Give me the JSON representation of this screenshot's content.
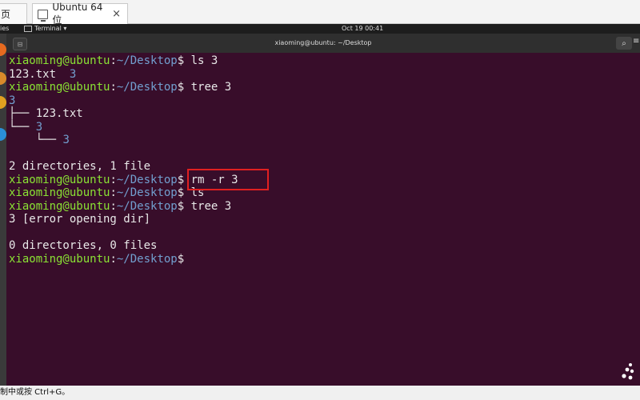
{
  "tabs": [
    {
      "label": "页",
      "close": ""
    },
    {
      "label": "Ubuntu 64 位",
      "close": "×"
    }
  ],
  "topbar": {
    "activities": "ies",
    "app_menu": "Terminal ▾",
    "clock": "Oct 19  00:41"
  },
  "terminal": {
    "window_title": "xiaoming@ubuntu: ~/Desktop",
    "prompt_user": "xiaoming@ubuntu",
    "prompt_path": "~/Desktop",
    "lines": [
      {
        "kind": "prompt",
        "cmd": "ls 3"
      },
      {
        "kind": "ls_output",
        "file": "123.txt",
        "dir": "3"
      },
      {
        "kind": "prompt",
        "cmd": "tree 3"
      },
      {
        "kind": "output",
        "text": "3",
        "is_dir": true
      },
      {
        "kind": "output",
        "text": "├── 123.txt"
      },
      {
        "kind": "tree_dir",
        "prefix": "└── ",
        "dir": "3"
      },
      {
        "kind": "tree_dir",
        "prefix": "    └── ",
        "dir": "3"
      },
      {
        "kind": "blank"
      },
      {
        "kind": "output",
        "text": "2 directories, 1 file"
      },
      {
        "kind": "prompt",
        "cmd": "rm -r 3",
        "highlighted": true
      },
      {
        "kind": "prompt",
        "cmd": "ls"
      },
      {
        "kind": "prompt",
        "cmd": "tree 3"
      },
      {
        "kind": "output",
        "text": "3 [error opening dir]"
      },
      {
        "kind": "blank"
      },
      {
        "kind": "output",
        "text": "0 directories, 0 files"
      },
      {
        "kind": "prompt",
        "cmd": ""
      }
    ]
  },
  "statusbar": {
    "text": "制中或按 Ctrl+G。"
  },
  "icons": {
    "search": "search-icon",
    "menu": "hamburger-menu-icon",
    "new_tab": "new-tab-icon",
    "vm": "vm-display-icon"
  },
  "colors": {
    "terminal_bg": "#380d2a",
    "prompt_user": "#8ae234",
    "prompt_path": "#729fcf",
    "highlight_box": "#e02020"
  }
}
